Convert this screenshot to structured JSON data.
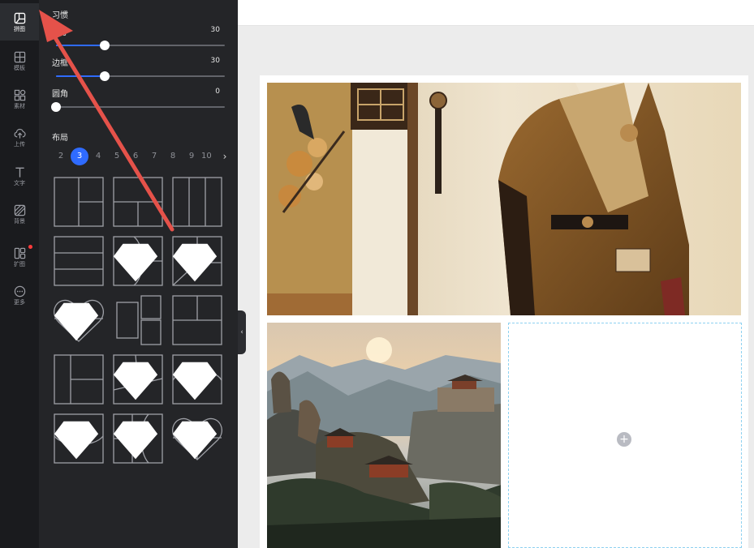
{
  "rail": {
    "items": [
      {
        "label": "拼图",
        "icon": "collage-icon",
        "active": true
      },
      {
        "label": "模板",
        "icon": "template-icon"
      },
      {
        "label": "素材",
        "icon": "materials-icon"
      },
      {
        "label": "上传",
        "icon": "upload-icon"
      },
      {
        "label": "文字",
        "icon": "text-icon"
      },
      {
        "label": "背景",
        "icon": "background-icon"
      },
      {
        "label": "扩图",
        "icon": "expand-image-icon",
        "badge": "red-dot"
      },
      {
        "label": "更多",
        "icon": "more-icon"
      }
    ]
  },
  "panel": {
    "habit_title": "习惯",
    "sliders": [
      {
        "label": "尺寸",
        "value": "30",
        "fraction": 0.29
      },
      {
        "label": "边框",
        "value": "30",
        "fraction": 0.29
      },
      {
        "label": "圆角",
        "value": "0",
        "fraction": 0
      }
    ],
    "layout_title": "布局",
    "pages": [
      "2",
      "3",
      "4",
      "5",
      "6",
      "7",
      "8",
      "9",
      "10"
    ],
    "current_page": "3",
    "next_icon": "chevron-right-icon"
  },
  "canvas": {
    "add_icon": "plus-icon",
    "empty_cell_border_color": "#8ed1f0"
  },
  "colors": {
    "accent": "#2f6bff",
    "panel_bg": "#242528",
    "rail_bg": "#1a1b1e",
    "annotation_arrow": "#e5524a"
  }
}
